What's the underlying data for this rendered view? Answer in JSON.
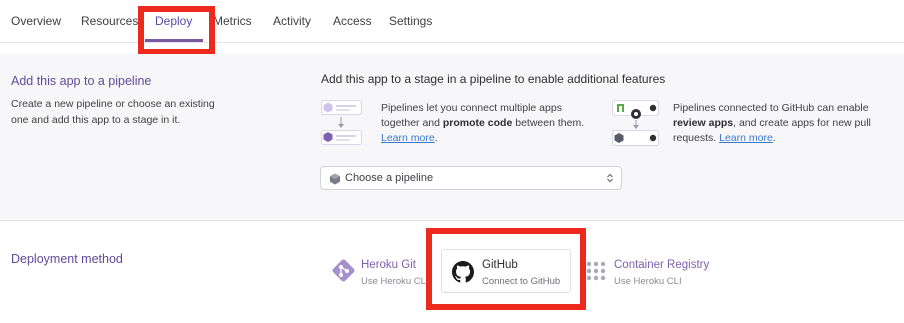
{
  "tabs": [
    {
      "label": "Overview"
    },
    {
      "label": "Resources"
    },
    {
      "label": "Deploy"
    },
    {
      "label": "Metrics"
    },
    {
      "label": "Activity"
    },
    {
      "label": "Access"
    },
    {
      "label": "Settings"
    }
  ],
  "active_tab": "Deploy",
  "pipeline": {
    "title": "Add this app to a pipeline",
    "description": "Create a new pipeline or choose an existing one and add this app to a stage in it.",
    "stage_title": "Add this app to a stage in a pipeline to enable additional features",
    "feature1": {
      "text_before": "Pipelines let you connect multiple apps together and ",
      "bold": "promote code",
      "text_after": " between them.",
      "link": "Learn more",
      "link_suffix": "."
    },
    "feature2": {
      "text_before": "Pipelines connected to GitHub can enable ",
      "bold": "review apps",
      "text_after": ", and create apps for new pull requests.",
      "link": "Learn more",
      "link_suffix": "."
    },
    "select_label": "Choose a pipeline"
  },
  "deployment": {
    "title": "Deployment method",
    "methods": [
      {
        "name": "Heroku Git",
        "sub": "Use Heroku CLI"
      },
      {
        "name": "GitHub",
        "sub": "Connect to GitHub"
      },
      {
        "name": "Container Registry",
        "sub": "Use Heroku CLI"
      }
    ]
  },
  "colors": {
    "accent": "#79589f",
    "highlight": "#ee2a1f",
    "link": "#3b79c9"
  }
}
